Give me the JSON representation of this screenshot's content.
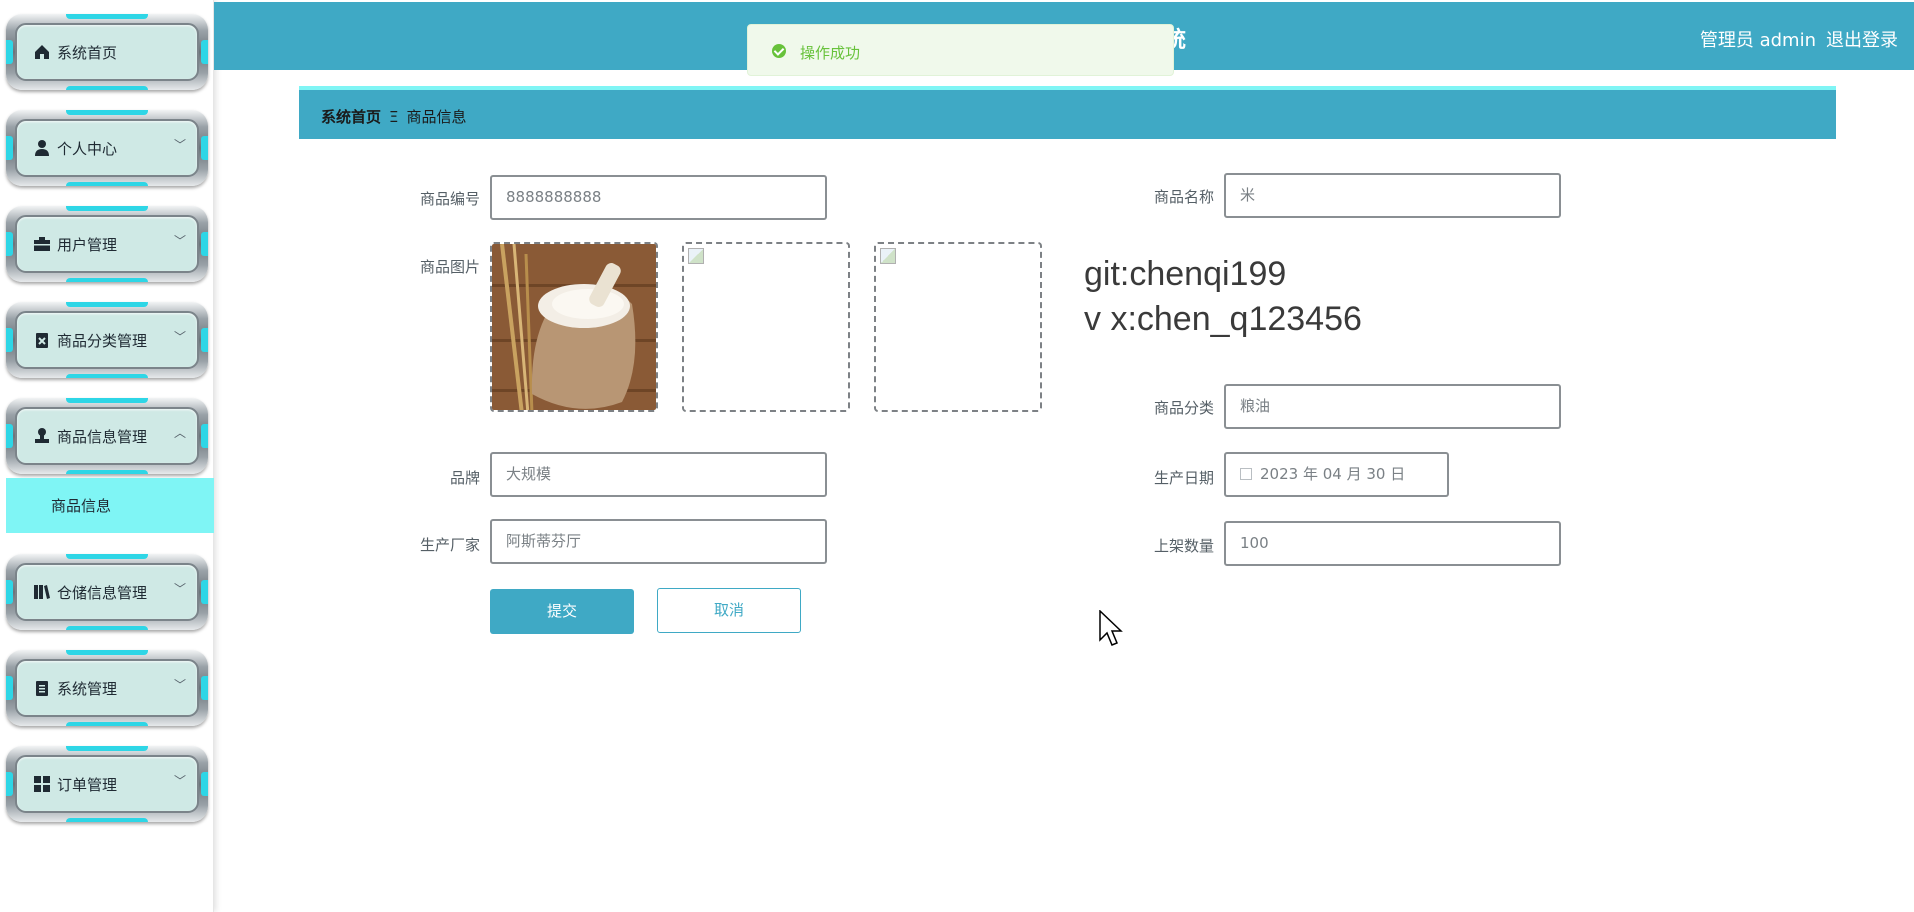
{
  "sidebar": {
    "items": [
      {
        "label": "系统首页",
        "icon": "home-icon",
        "chevron": ""
      },
      {
        "label": "个人中心",
        "icon": "user-icon",
        "chevron": "﹀"
      },
      {
        "label": "用户管理",
        "icon": "briefcase-icon",
        "chevron": "﹀"
      },
      {
        "label": "商品分类管理",
        "icon": "clipboard-x-icon",
        "chevron": "﹀"
      },
      {
        "label": "商品信息管理",
        "icon": "stamp-icon",
        "chevron": "︿"
      },
      {
        "label": "仓储信息管理",
        "icon": "books-icon",
        "chevron": "﹀"
      },
      {
        "label": "系统管理",
        "icon": "clipboard-icon",
        "chevron": "﹀"
      },
      {
        "label": "订单管理",
        "icon": "grid-icon",
        "chevron": "﹀"
      }
    ],
    "submenu": {
      "label": "商品信息"
    }
  },
  "header": {
    "title": "统",
    "user": "管理员 admin",
    "logout": "退出登录",
    "color": "#3fa9c5"
  },
  "toast": {
    "text": "操作成功",
    "color": "#67c23a"
  },
  "breadcrumb": {
    "home": "系统首页",
    "separator": "Ξ",
    "current": "商品信息"
  },
  "form": {
    "product_code": {
      "label": "商品编号",
      "value": "8888888888"
    },
    "product_name": {
      "label": "商品名称",
      "value": "米"
    },
    "product_image": {
      "label": "商品图片"
    },
    "category": {
      "label": "商品分类",
      "value": "粮油"
    },
    "brand": {
      "label": "品牌",
      "value": "大规模"
    },
    "production_date": {
      "label": "生产日期",
      "value": "2023 年 04 月 30 日"
    },
    "manufacturer": {
      "label": "生产厂家",
      "value": "阿斯蒂芬厅"
    },
    "quantity": {
      "label": "上架数量",
      "value": "100"
    },
    "submit_label": "提交",
    "cancel_label": "取消"
  },
  "watermark": {
    "line1": "git:chenqi199",
    "line2": "v x:chen_q123456"
  }
}
